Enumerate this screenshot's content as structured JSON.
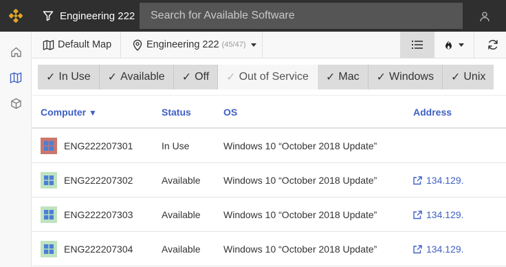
{
  "topbar": {
    "lab_name": "Engineering 222",
    "search_placeholder": "Search for Available Software"
  },
  "toolbar": {
    "map_label": "Default Map",
    "location_label": "Engineering 222",
    "location_count": "(45/47)"
  },
  "filters": {
    "status": [
      {
        "label": "In Use",
        "checked": true
      },
      {
        "label": "Available",
        "checked": true
      },
      {
        "label": "Off",
        "checked": true
      },
      {
        "label": "Out of Service",
        "checked": false
      }
    ],
    "os": [
      {
        "label": "Mac",
        "checked": true
      },
      {
        "label": "Windows",
        "checked": true
      },
      {
        "label": "Unix",
        "checked": true
      }
    ],
    "check_glyph": "✓"
  },
  "table": {
    "headers": {
      "computer": "Computer",
      "status": "Status",
      "os": "OS",
      "address": "Address"
    },
    "sort_indicator": "▼",
    "rows": [
      {
        "computer": "ENG222207301",
        "status": "In Use",
        "os": "Windows 10 “October 2018 Update”",
        "address": "",
        "status_color": "#c8776f"
      },
      {
        "computer": "ENG222207302",
        "status": "Available",
        "os": "Windows 10 “October 2018 Update”",
        "address": "134.129.",
        "status_color": "#bfe3bf"
      },
      {
        "computer": "ENG222207303",
        "status": "Available",
        "os": "Windows 10 “October 2018 Update”",
        "address": "134.129.",
        "status_color": "#bfe3bf"
      },
      {
        "computer": "ENG222207304",
        "status": "Available",
        "os": "Windows 10 “October 2018 Update”",
        "address": "134.129.",
        "status_color": "#bfe3bf"
      }
    ]
  },
  "colors": {
    "accent": "#3d5fc4",
    "topbar": "#2f2f2f",
    "logo": "#e0a526"
  },
  "icons": {
    "logo": "diamond-logo-icon",
    "filter": "filter-icon",
    "user": "user-icon",
    "home": "home-icon",
    "map": "map-icon",
    "box": "box-icon",
    "location": "location-pin-icon",
    "list": "list-icon",
    "heat": "flame-icon",
    "refresh": "refresh-icon",
    "windows": "windows-icon",
    "external": "external-link-icon"
  }
}
